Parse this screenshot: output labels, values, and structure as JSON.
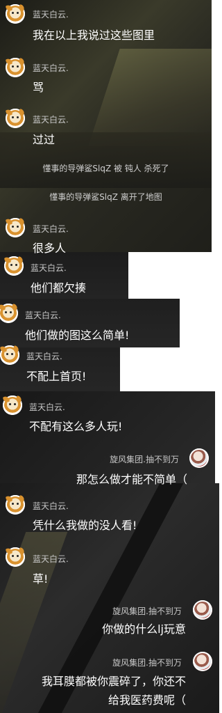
{
  "colors": {
    "text": "#ffffff",
    "name": "#c8c8c8",
    "system": "#cfcfcf",
    "panel": "#222222"
  },
  "messages": [
    {
      "side": "left",
      "user": "蓝天白云.",
      "text": "我在以上我说过这些图里"
    },
    {
      "side": "left",
      "user": "蓝天白云.",
      "text": "骂"
    },
    {
      "side": "left",
      "user": "蓝天白云.",
      "text": "过过"
    },
    {
      "side": "left",
      "user": "蓝天白云.",
      "text": "很多人"
    },
    {
      "side": "left",
      "user": "蓝天白云.",
      "text": "他们都欠揍"
    },
    {
      "side": "left",
      "user": "蓝天白云.",
      "text": "他们做的图这么简单!"
    },
    {
      "side": "left",
      "user": "蓝天白云.",
      "text": "不配上首页!"
    },
    {
      "side": "left",
      "user": "蓝天白云.",
      "text": "不配有这么多人玩!"
    },
    {
      "side": "right",
      "user": "旋风集团.抽不到万",
      "text": "那怎么做才能不简单（"
    },
    {
      "side": "left",
      "user": "蓝天白云.",
      "text": "凭什么我做的没人看!"
    },
    {
      "side": "left",
      "user": "蓝天白云.",
      "text": "草!"
    },
    {
      "side": "right",
      "user": "旋风集团.抽不到万",
      "text": "你做的什么lj玩意"
    },
    {
      "side": "right",
      "user": "旋风集团.抽不到万",
      "text_line1": "我耳膜都被你震碎了，你还不",
      "text_line2": "给我医药费呢（"
    }
  ],
  "system": [
    "懂事的导弹鲨SlqZ 被 钝人 杀死了",
    "懂事的导弹鲨SlqZ 离开了地图"
  ]
}
